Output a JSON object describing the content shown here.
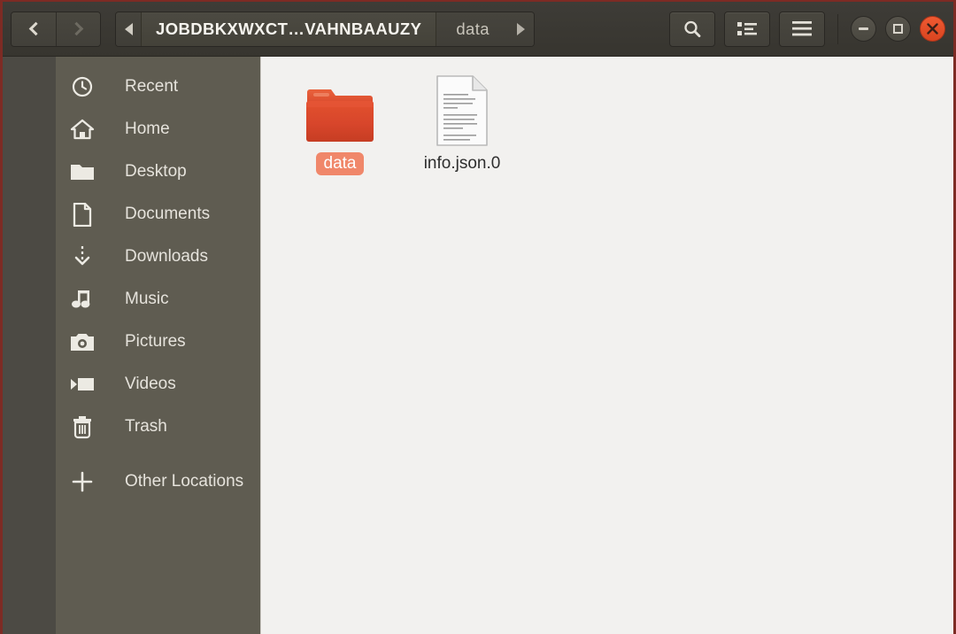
{
  "window": {
    "title": "JOBDBKXWXCT…VAHNBAAUZY",
    "accent_color": "#d9441f",
    "sidebar_bg": "#5f5c51",
    "header_bg": "#37352f",
    "content_bg": "#f2f1ef",
    "selection_color": "#f0876a"
  },
  "toolbar": {
    "back_label": "Back",
    "forward_label": "Forward",
    "search_label": "Search",
    "view_toggle_label": "Toggle view",
    "menu_label": "Menu",
    "minimize_label": "Minimize",
    "maximize_label": "Maximize",
    "close_label": "Close"
  },
  "pathbar": {
    "scroll_left_label": "Scroll path left",
    "scroll_right_label": "Scroll path right",
    "segments": [
      {
        "label": "JOBDBKXWXCT…VAHNBAAUZY",
        "current": true
      },
      {
        "label": "data",
        "current": false
      }
    ]
  },
  "sidebar": {
    "items": [
      {
        "label": "Recent",
        "icon": "clock-icon"
      },
      {
        "label": "Home",
        "icon": "home-icon"
      },
      {
        "label": "Desktop",
        "icon": "folder-icon"
      },
      {
        "label": "Documents",
        "icon": "document-icon"
      },
      {
        "label": "Downloads",
        "icon": "download-icon"
      },
      {
        "label": "Music",
        "icon": "music-note-icon"
      },
      {
        "label": "Pictures",
        "icon": "camera-icon"
      },
      {
        "label": "Videos",
        "icon": "video-camera-icon"
      },
      {
        "label": "Trash",
        "icon": "trash-icon"
      },
      {
        "label": "Other Locations",
        "icon": "plus-icon"
      }
    ]
  },
  "content": {
    "files": [
      {
        "name": "data",
        "type": "folder",
        "selected": true
      },
      {
        "name": "info.json.0",
        "type": "document",
        "selected": false
      }
    ]
  }
}
